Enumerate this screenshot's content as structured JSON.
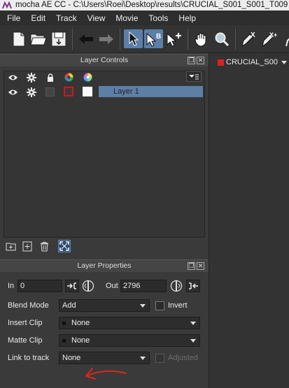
{
  "window": {
    "title": "mocha AE CC - C:\\Users\\Roei\\Desktop\\results\\CRUCIAL_S001_S001_T009"
  },
  "menu": [
    "File",
    "Edit",
    "Track",
    "View",
    "Movie",
    "Tools",
    "Help"
  ],
  "toolbar": {
    "icons": [
      "new-file-icon",
      "open-folder-icon",
      "save-icon",
      "undo-icon",
      "redo-icon",
      "pick-tool-icon",
      "select-b-icon",
      "add-point-icon",
      "hand-icon",
      "zoom-icon",
      "pen-x-icon",
      "pen-x-plus-icon"
    ]
  },
  "layer_controls": {
    "title": "Layer Controls",
    "layer_name": "Layer 1"
  },
  "layer_properties": {
    "title": "Layer Properties",
    "in_label": "In",
    "in_value": "0",
    "out_label": "Out",
    "out_value": "2796",
    "blend_mode_label": "Blend Mode",
    "blend_mode_value": "Add",
    "invert_label": "Invert",
    "insert_clip_label": "Insert Clip",
    "insert_clip_value": "None",
    "matte_clip_label": "Matte Clip",
    "matte_clip_value": "None",
    "link_to_track_label": "Link to track",
    "link_to_track_value": "None",
    "adjusted_label": "Adjusted"
  },
  "viewer_tab": {
    "label": "CRUCIAL_S00",
    "color": "#e0201c"
  },
  "colors": {
    "selection": "#5d7ea5",
    "annotation_arrow": "#d8281c"
  }
}
